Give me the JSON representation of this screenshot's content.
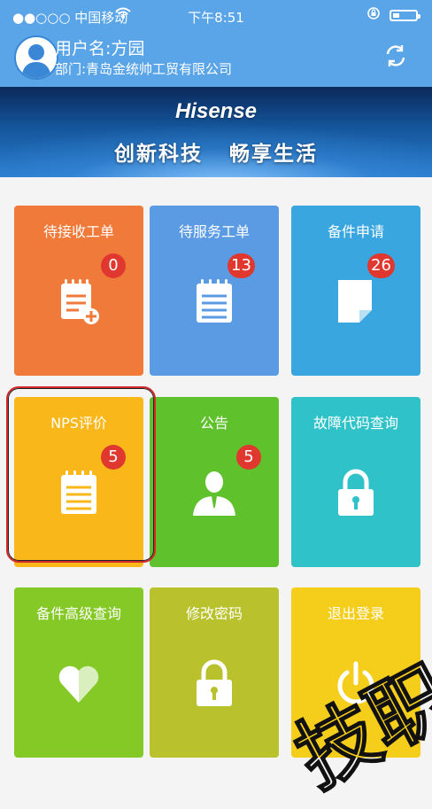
{
  "status_bar": {
    "carrier": "●●○○○ 中国移动",
    "time": "下午8:51"
  },
  "user": {
    "name_line": "用户名:方园",
    "dept_line": "部门:青岛金统帅工贸有限公司"
  },
  "banner": {
    "brand": "Hisense",
    "slogan": "创新科技 畅享生活"
  },
  "tiles": [
    {
      "label": "待接收工单",
      "badge": "0",
      "color": "#f07a3a",
      "icon": "notepad-add-icon"
    },
    {
      "label": "待服务工单",
      "badge": "13",
      "color": "#5b9be3",
      "icon": "notepad-icon"
    },
    {
      "label": "备件申请",
      "badge": "26",
      "color": "#3aa6e0",
      "icon": "document-icon"
    },
    {
      "label": "NPS评价",
      "badge": "5",
      "color": "#f9b71a",
      "icon": "notepad-icon"
    },
    {
      "label": "公告",
      "badge": "5",
      "color": "#5fc12c",
      "icon": "person-icon"
    },
    {
      "label": "故障代码查询",
      "badge": "",
      "color": "#2fc3c9",
      "icon": "lock-icon"
    },
    {
      "label": "备件高级查询",
      "badge": "",
      "color": "#84c925",
      "icon": "heart-icon"
    },
    {
      "label": "修改密码",
      "badge": "",
      "color": "#b9c22c",
      "icon": "lock-icon"
    },
    {
      "label": "退出登录",
      "badge": "",
      "color": "#f5ce1b",
      "icon": "power-icon"
    }
  ],
  "watermark": "技职"
}
